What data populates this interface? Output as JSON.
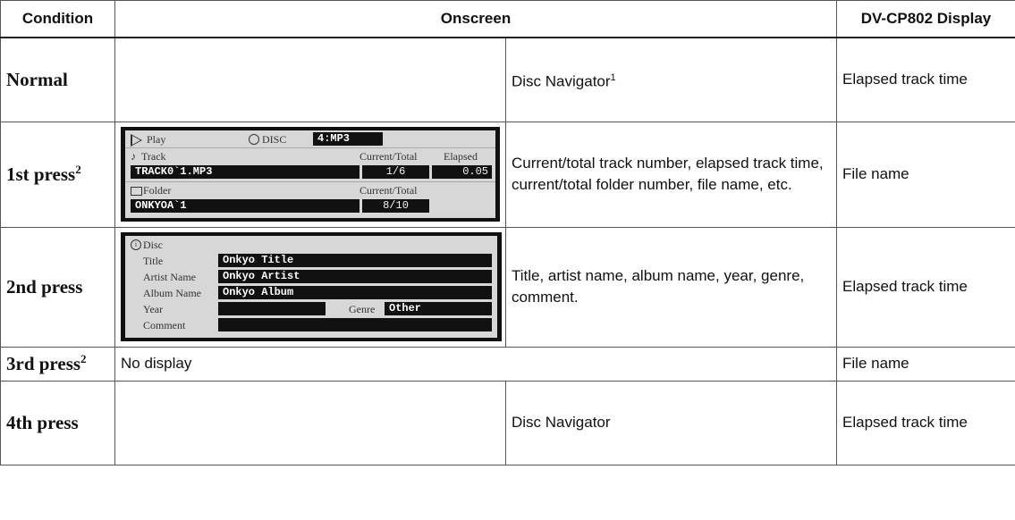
{
  "headers": {
    "condition": "Condition",
    "onscreen": "Onscreen",
    "display": "DV-CP802 Display"
  },
  "rows": [
    {
      "condition": "Normal",
      "sup": "",
      "description": "Disc Navigator",
      "description_sup": "1",
      "display": "Elapsed track time"
    },
    {
      "condition": "1st press",
      "sup": "2",
      "description": "Current/total track number, elapsed track time, current/total folder number, file name, etc.",
      "display": "File name"
    },
    {
      "condition": "2nd press",
      "sup": "",
      "description": "Title, artist name, album name, year, genre, comment.",
      "display": "Elapsed track time"
    },
    {
      "condition": "3rd press",
      "sup": "2",
      "description": "No display",
      "display": "File name"
    },
    {
      "condition": "4th press",
      "sup": "",
      "description": "Disc Navigator",
      "display": "Elapsed track time"
    }
  ],
  "osd1": {
    "play_label": "Play",
    "disc_label": "DISC",
    "disc_value": "4:MP3",
    "track_label": "Track",
    "current_total_label": "Current/Total",
    "elapsed_label": "Elapsed",
    "track_file": "TRACK0`1.MP3",
    "track_count": "1/6",
    "elapsed_value": "0.05",
    "folder_label": "Folder",
    "folder_current_total_label": "Current/Total",
    "folder_name": "ONKYOA`1",
    "folder_count": "8/10",
    "icons": [
      "play-icon",
      "disc-icon",
      "music-note-icon",
      "folder-icon"
    ]
  },
  "osd2": {
    "disc_label": "Disc",
    "title_label": "Title",
    "title_value": "Onkyo Title",
    "artist_label": "Artist Name",
    "artist_value": "Onkyo Artist",
    "album_label": "Album Name",
    "album_value": "Onkyo Album",
    "year_label": "Year",
    "year_value": "",
    "genre_label": "Genre",
    "genre_value": "Other",
    "comment_label": "Comment",
    "comment_value": "",
    "icons": [
      "info-icon"
    ]
  }
}
